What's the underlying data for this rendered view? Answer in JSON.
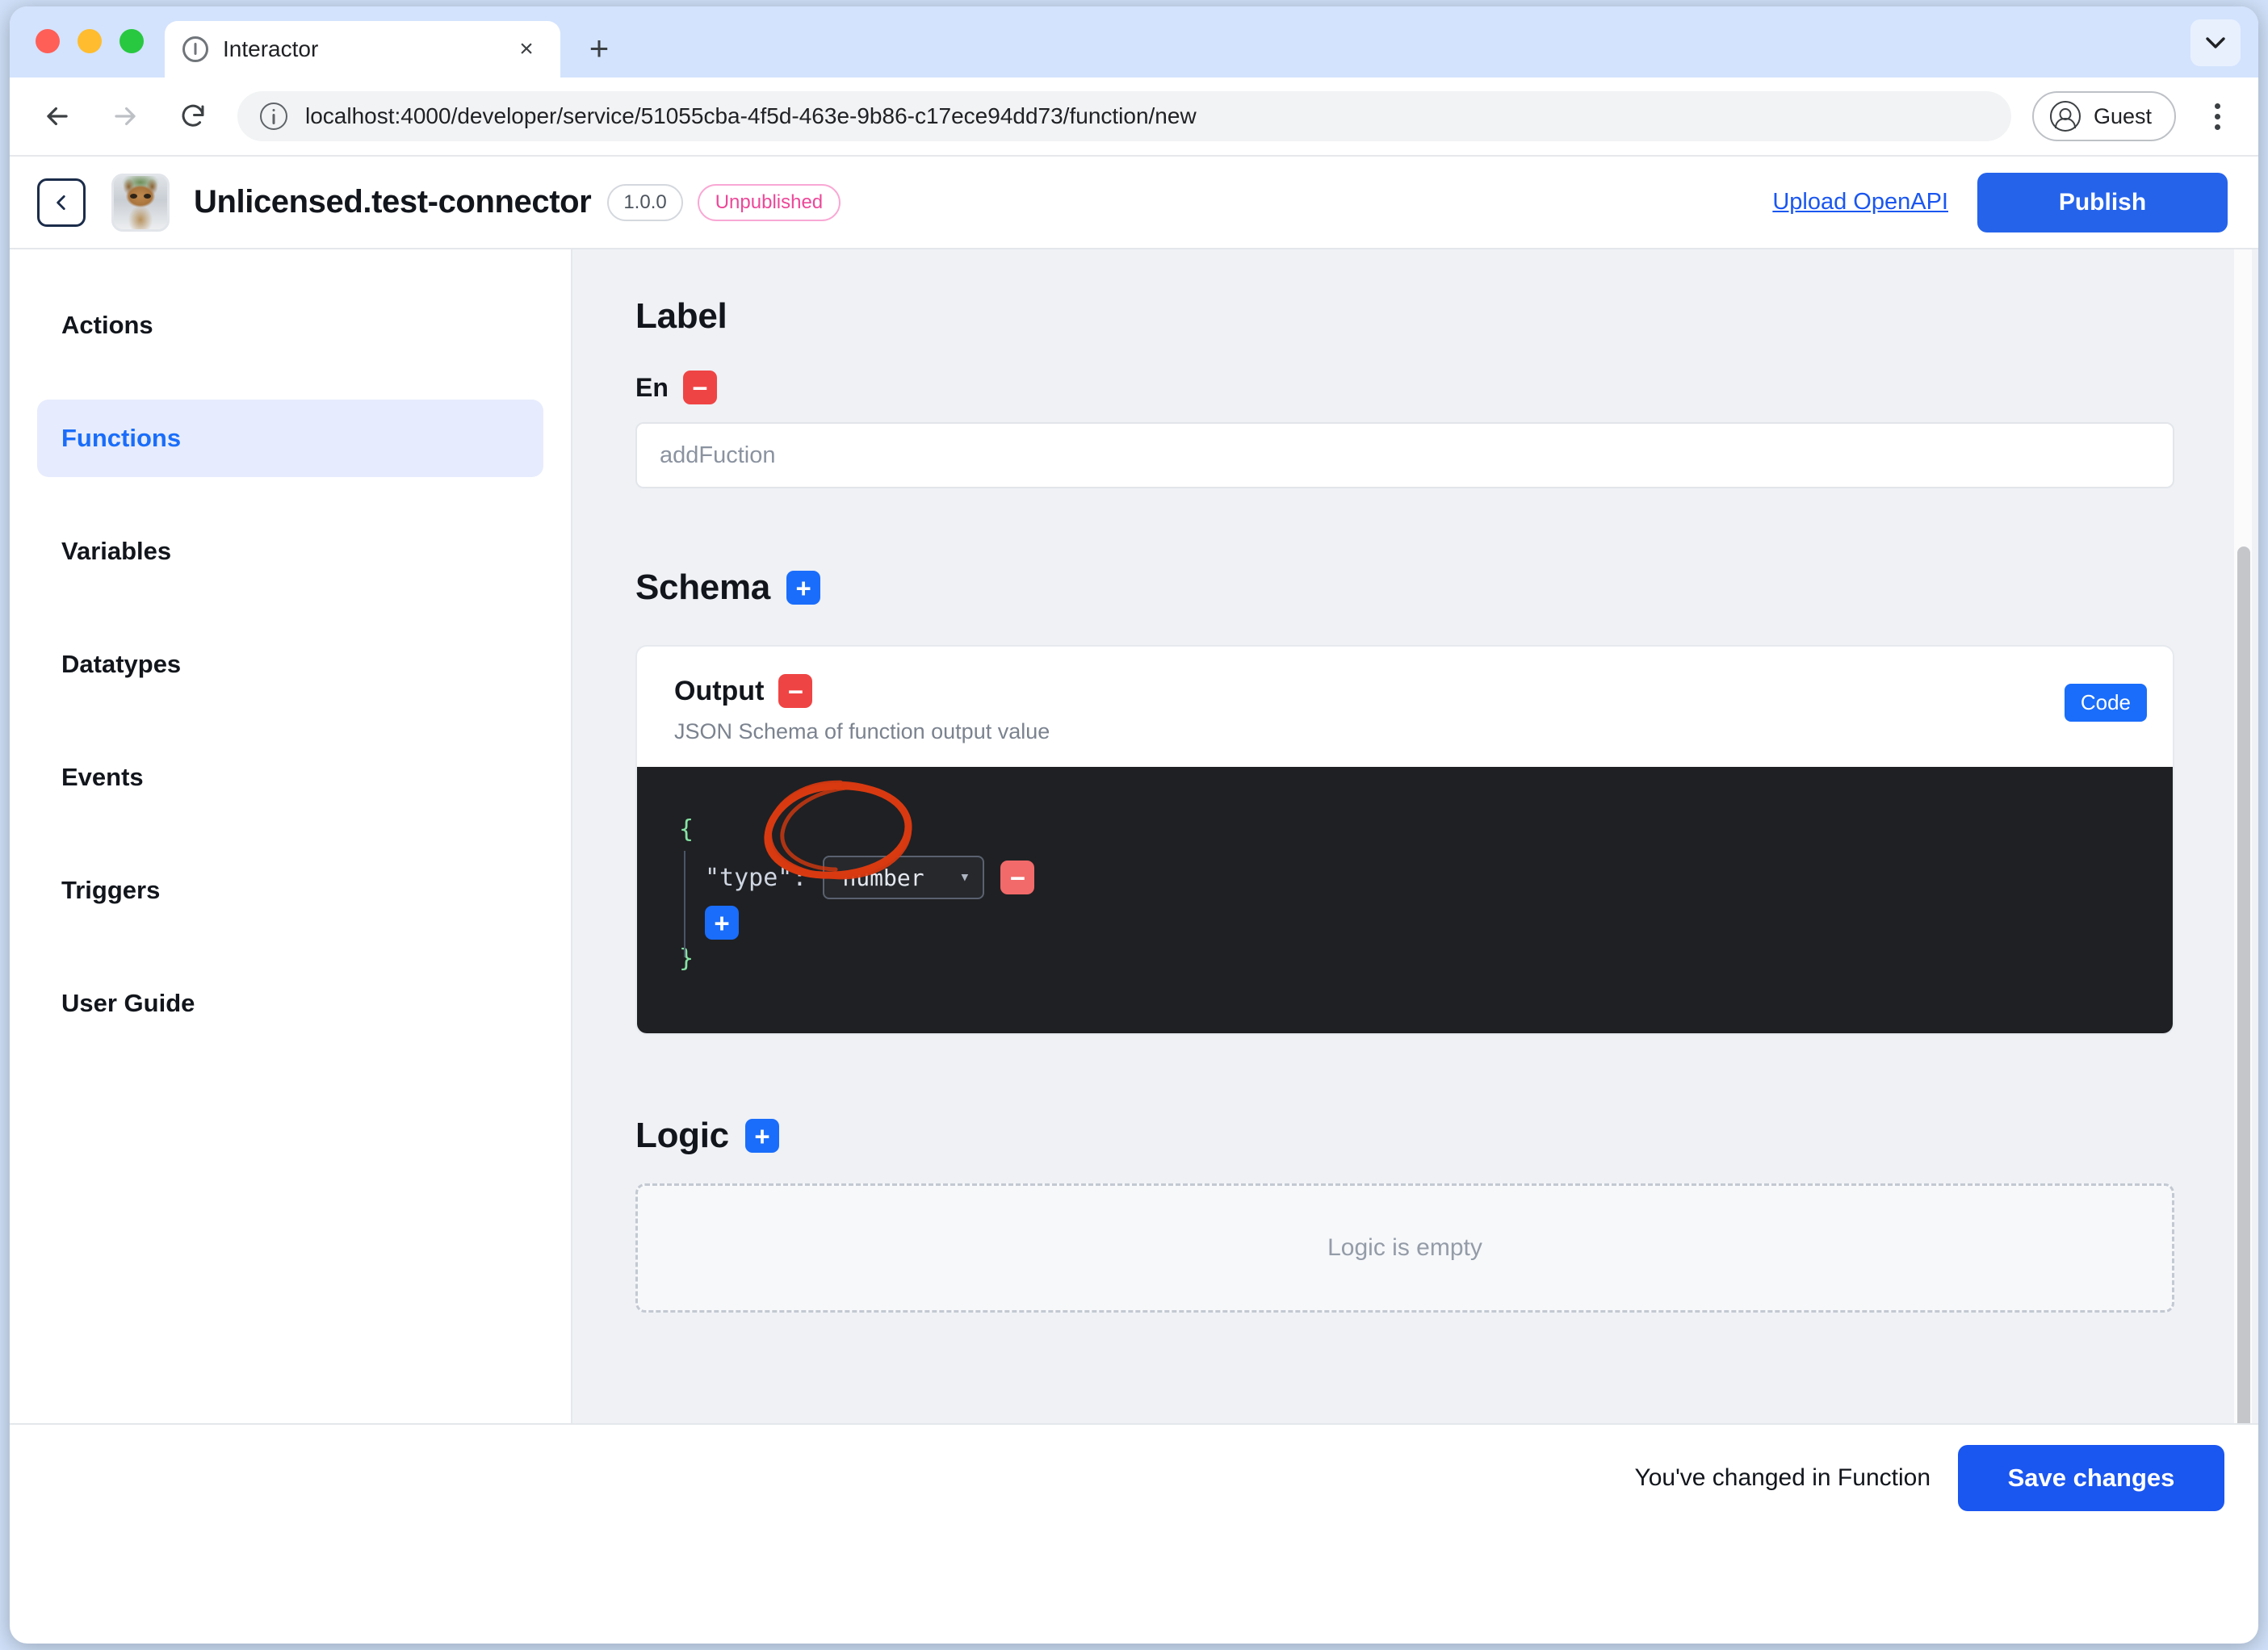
{
  "browser": {
    "tab": {
      "title": "Interactor",
      "favicon": "info-circle-icon",
      "close": "×"
    },
    "new_tab_label": "+",
    "tab_list_icon": "chevron-down-icon",
    "toolbar": {
      "back_icon": "arrow-left-icon",
      "forward_icon": "arrow-right-icon",
      "reload_icon": "reload-icon",
      "site_info_icon": "info-circle-icon",
      "url": "localhost:4000/developer/service/51055cba-4f5d-463e-9b86-c17ece94dd73/function/new",
      "profile_label": "Guest",
      "profile_icon": "account-circle-icon",
      "menu_icon": "kebab-menu-icon"
    }
  },
  "app_header": {
    "back_icon": "chevron-left-icon",
    "avatar": "cat-avatar",
    "title": "Unlicensed.test-connector",
    "version": "1.0.0",
    "status": "Unpublished",
    "upload_link": "Upload OpenAPI",
    "publish_label": "Publish"
  },
  "sidebar": {
    "items": [
      {
        "label": "Actions",
        "active": false
      },
      {
        "label": "Functions",
        "active": true
      },
      {
        "label": "Variables",
        "active": false
      },
      {
        "label": "Datatypes",
        "active": false
      },
      {
        "label": "Events",
        "active": false
      },
      {
        "label": "Triggers",
        "active": false
      },
      {
        "label": "User Guide",
        "active": false
      }
    ]
  },
  "main": {
    "label_section": {
      "heading": "Label",
      "remove_icon": "minus-icon",
      "lang": "En",
      "input_value": "addFuction",
      "input_placeholder": "addFuction"
    },
    "schema_section": {
      "heading": "Schema",
      "add_icon": "plus-icon",
      "output_card": {
        "title": "Output",
        "remove_icon": "minus-icon",
        "subtitle": "JSON Schema of function output value",
        "code_chip": "Code",
        "editor": {
          "open_brace": "{",
          "close_brace": "}",
          "property_key": "\"type\":",
          "property_value": "number",
          "chevron_icon": "chevron-down-icon",
          "remove_icon": "minus-icon",
          "add_icon": "plus-icon"
        },
        "annotation": "red-circle-annotation"
      }
    },
    "logic_section": {
      "heading": "Logic",
      "add_icon": "plus-icon",
      "empty_text": "Logic is empty"
    }
  },
  "footer": {
    "message": "You've changed in Function",
    "save_label": "Save changes"
  },
  "colors": {
    "accent_blue": "#1a6dfa",
    "publish_blue": "#2563eb",
    "danger_red": "#ef4444",
    "status_pink": "#ec4899",
    "editor_bg": "#1f2023",
    "annotation_red": "#d93a10"
  }
}
